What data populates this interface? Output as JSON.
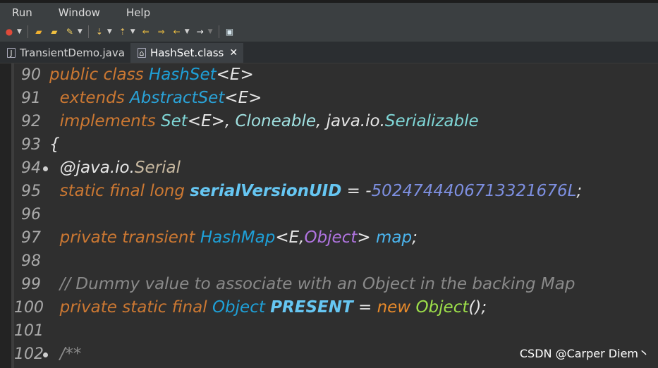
{
  "menu": [
    "Run",
    "Window",
    "Help"
  ],
  "tabs": [
    {
      "label": "TransientDemo.java",
      "icon": "java-file-icon",
      "active": false
    },
    {
      "label": "HashSet.class",
      "icon": "class-file-icon",
      "active": true
    }
  ],
  "tab_close": "✕",
  "editor": {
    "line_numbers": [
      "90",
      "91",
      "92",
      "93",
      "94",
      "95",
      "96",
      "97",
      "98",
      "99",
      "100",
      "101",
      "102"
    ],
    "tokens": {
      "public_class": "public class ",
      "HashSet": "HashSet",
      "E_generic": "<E>",
      "extends": "extends ",
      "AbstractSet": "AbstractSet",
      "implements": "implements ",
      "Set": "Set",
      "E_comma": "<E>, ",
      "Cloneable": "Cloneable",
      "comma": ", ",
      "java_io": "java.io.",
      "Serializable": "Serializable",
      "open_brace": "{",
      "at_java_io": "@java.io.",
      "Serial": "Serial",
      "static_final_long": "static final long ",
      "serialVersionUID": "serialVersionUID",
      "assign_minus": " = -",
      "uid_value": "5024744406713321676L",
      "semicolon": ";",
      "private_transient": "private transient ",
      "HashMap": "HashMap",
      "lt_E_comma": "<E,",
      "Object_generic": "Object",
      "gt": "> ",
      "map": "map",
      "comment": "// Dummy value to associate with an Object in the backing Map",
      "private_static_final": "private static final ",
      "Object_type": "Object",
      "space": " ",
      "PRESENT": "PRESENT",
      "assign": " = ",
      "new": "new ",
      "Object_ctor": "Object",
      "parens_semicolon": "();",
      "javadoc_open": "/**"
    }
  },
  "watermark": "CSDN @Carper Diem丶"
}
